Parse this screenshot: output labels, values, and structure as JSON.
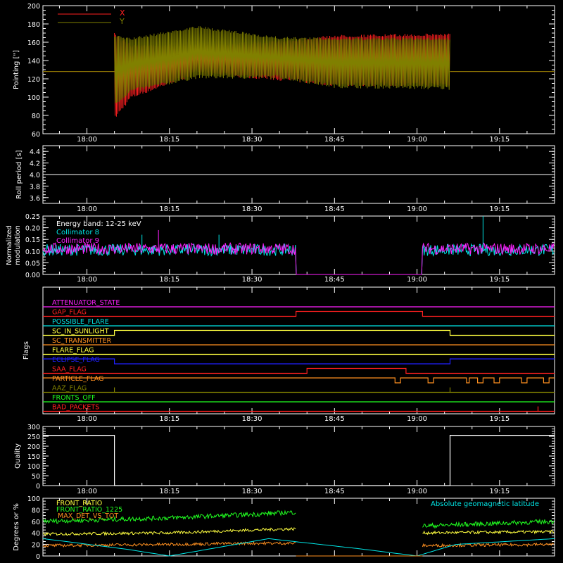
{
  "time_ticks": [
    "18:00",
    "18:15",
    "18:30",
    "18:45",
    "19:00",
    "19:15"
  ],
  "colors": {
    "background": "#000000",
    "axes": "#ffffff",
    "x_series": "#ff2020",
    "y_series": "#808000",
    "cyan": "#00e5e5",
    "magenta": "#ff20ff",
    "yellow": "#ffff40",
    "orange": "#ff9020",
    "green": "#20ff20",
    "red": "#ff2020",
    "blue": "#2020ff"
  },
  "chart_data": [
    {
      "id": "pointing",
      "type": "line",
      "ylabel": "Pointing [\"]",
      "ylim": [
        60,
        200
      ],
      "yticks": [
        "60",
        "80",
        "100",
        "120",
        "140",
        "160",
        "180",
        "200"
      ],
      "xlim": [
        "17:52",
        "19:25"
      ],
      "legend_position": "top-left",
      "series": [
        {
          "name": "X",
          "color": "#ff2020",
          "envelope_time": [
            "18:05",
            "18:08",
            "18:20",
            "18:35",
            "18:45",
            "19:06"
          ],
          "upper": [
            170,
            158,
            158,
            162,
            168,
            170
          ],
          "lower": [
            75,
            98,
            125,
            118,
            112,
            112
          ],
          "baseline": 128
        },
        {
          "name": "Y",
          "color": "#808000",
          "envelope_time": [
            "18:05",
            "18:08",
            "18:20",
            "18:35",
            "18:45",
            "19:06"
          ],
          "upper": [
            168,
            165,
            178,
            166,
            165,
            165
          ],
          "lower": [
            90,
            105,
            120,
            120,
            110,
            108
          ],
          "baseline": 128
        }
      ]
    },
    {
      "id": "roll-period",
      "type": "line",
      "ylabel": "Roll period [s]",
      "ylim": [
        3.5,
        4.5
      ],
      "yticks": [
        "3.6",
        "3.8",
        "4.0",
        "4.2",
        "4.4"
      ],
      "series": [
        {
          "color": "#ffffff",
          "x": [
            "17:52",
            "19:25"
          ],
          "y": [
            4.0,
            4.0
          ]
        }
      ]
    },
    {
      "id": "modulation",
      "type": "line",
      "ylabel": "Normalized modulation",
      "ylim": [
        0,
        0.25
      ],
      "yticks": [
        "0.00",
        "0.05",
        "0.10",
        "0.15",
        "0.20",
        "0.25"
      ],
      "annotation": "Energy band: 12-25 keV",
      "series": [
        {
          "name": "Collimator 8",
          "color": "#00e5e5",
          "segments": [
            [
              "17:52",
              "18:38"
            ],
            [
              "19:01",
              "19:25"
            ]
          ],
          "mean": 0.105,
          "gap_value": 0.0
        },
        {
          "name": "Collimator 9",
          "color": "#ff20ff",
          "segments": [
            [
              "17:52",
              "18:38"
            ],
            [
              "19:01",
              "19:25"
            ]
          ],
          "mean": 0.11,
          "gap_value": 0.0
        }
      ]
    },
    {
      "id": "flags",
      "type": "line",
      "ylabel": "Flags",
      "series": [
        {
          "name": "ATTENUATOR_STATE",
          "color": "#ff20ff",
          "x": [
            "17:52",
            "19:25"
          ],
          "y": [
            0,
            0
          ]
        },
        {
          "name": "GAP_FLAG",
          "color": "#ff2020",
          "x": [
            "17:52",
            "18:38",
            "18:38",
            "19:01",
            "19:01",
            "19:25"
          ],
          "y": [
            0,
            0,
            1,
            1,
            0,
            0
          ]
        },
        {
          "name": "POSSIBLE_FLARE",
          "color": "#00e5e5",
          "x": [
            "17:52",
            "19:25"
          ],
          "y": [
            0,
            0
          ]
        },
        {
          "name": "SC_IN_SUNLIGHT",
          "color": "#ffff40",
          "x": [
            "17:52",
            "18:05",
            "18:05",
            "19:06",
            "19:06",
            "19:25"
          ],
          "y": [
            0,
            0,
            1,
            1,
            0,
            0
          ]
        },
        {
          "name": "SC_TRANSMITTER",
          "color": "#ff9020",
          "x": [
            "17:52",
            "19:25"
          ],
          "y": [
            0,
            0
          ]
        },
        {
          "name": "FLARE_FLAG",
          "color": "#ffff40",
          "x": [
            "17:52",
            "19:25"
          ],
          "y": [
            0,
            0
          ]
        },
        {
          "name": "ECLIPSE_FLAG",
          "color": "#2020ff",
          "x": [
            "17:52",
            "18:05",
            "18:05",
            "19:06",
            "19:06",
            "19:25"
          ],
          "y": [
            1,
            1,
            0,
            0,
            1,
            1
          ]
        },
        {
          "name": "SAA_FLAG",
          "color": "#ff2020",
          "x": [
            "17:52",
            "18:40",
            "18:40",
            "18:58",
            "18:58",
            "19:25"
          ],
          "y": [
            0,
            0,
            1,
            1,
            0,
            0
          ]
        },
        {
          "name": "PARTICLE_FLAG",
          "color": "#ff9020",
          "x": [
            "17:52",
            "19:25"
          ],
          "y": [
            1,
            1
          ]
        },
        {
          "name": "AAZ_FLAG",
          "color": "#808000",
          "x": [
            "17:52",
            "18:05",
            "18:05",
            "18:05",
            "18:05",
            "19:06",
            "19:06",
            "19:06",
            "19:06",
            "19:25"
          ],
          "y": [
            0,
            0,
            1,
            1,
            0,
            0,
            1,
            1,
            0,
            0
          ]
        },
        {
          "name": "FRONTS_OFF",
          "color": "#20ff20",
          "x": [
            "17:52",
            "19:25"
          ],
          "y": [
            0,
            0
          ]
        },
        {
          "name": "BAD_PACKETS",
          "color": "#ff2020",
          "x": [
            "17:52",
            "19:22",
            "19:22",
            "19:22",
            "19:22",
            "19:25"
          ],
          "y": [
            0,
            0,
            1,
            1,
            0,
            0
          ]
        }
      ]
    },
    {
      "id": "quality",
      "type": "line",
      "ylabel": "Quality",
      "ylim": [
        0,
        300
      ],
      "yticks": [
        "0",
        "50",
        "100",
        "150",
        "200",
        "250",
        "300"
      ],
      "series": [
        {
          "color": "#ffffff",
          "x": [
            "17:52",
            "18:05",
            "18:05",
            "19:06",
            "19:06",
            "19:25"
          ],
          "y": [
            255,
            255,
            0,
            0,
            255,
            255
          ]
        }
      ]
    },
    {
      "id": "ratios",
      "type": "line",
      "ylabel": "Degrees or %",
      "ylim": [
        0,
        100
      ],
      "yticks": [
        "0",
        "20",
        "40",
        "60",
        "80",
        "100"
      ],
      "series": [
        {
          "name": "FRONT_RATIO",
          "color": "#ffff40",
          "x": [
            "17:52",
            "18:15",
            "18:30",
            "18:38",
            "18:38",
            "19:01",
            "19:01",
            "19:25"
          ],
          "y": [
            38,
            40,
            45,
            47,
            null,
            null,
            40,
            42
          ]
        },
        {
          "name": "FRONT_RATIO_1225",
          "color": "#20ff20",
          "x": [
            "17:52",
            "18:15",
            "18:30",
            "18:38",
            "18:38",
            "19:01",
            "19:01",
            "19:25"
          ],
          "y": [
            60,
            66,
            72,
            76,
            null,
            null,
            52,
            60
          ]
        },
        {
          "name": "MAX_DET_VS_TOT",
          "color": "#ff9020",
          "x": [
            "17:52",
            "18:15",
            "18:30",
            "18:38",
            "18:38",
            "19:01",
            "19:01",
            "19:25"
          ],
          "y": [
            18,
            20,
            22,
            22,
            null,
            null,
            18,
            20
          ]
        },
        {
          "name": "Absolute geomagnetic latitude",
          "color": "#00e5e5",
          "x": [
            "17:52",
            "18:07",
            "18:15",
            "18:33",
            "18:50",
            "19:00",
            "19:07",
            "19:25"
          ],
          "y": [
            30,
            12,
            0,
            30,
            12,
            0,
            20,
            30
          ]
        }
      ]
    }
  ]
}
